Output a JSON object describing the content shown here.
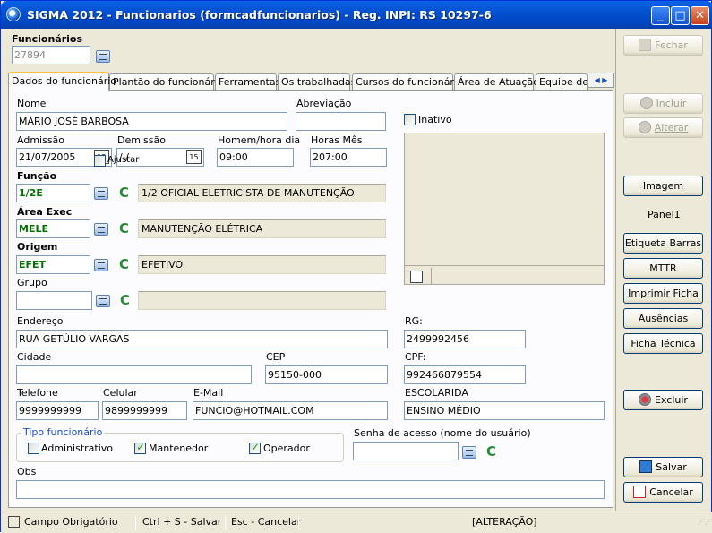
{
  "window": {
    "title": "SIGMA 2012 - Funcionarios  (formcadfuncionarios)  - Reg. INPI: RS 10297-6",
    "minimize": "_",
    "maximize": "□",
    "close": "✕"
  },
  "header": {
    "funcionarios_label": "Funcionários",
    "funcionario_code": "27894"
  },
  "tabs": [
    {
      "label": "Dados do funcionário"
    },
    {
      "label": "Plantão do funcionário"
    },
    {
      "label": "Ferramentas"
    },
    {
      "label": "Os trabalhadas"
    },
    {
      "label": "Cursos do funcionário"
    },
    {
      "label": "Área de Atuação"
    },
    {
      "label": "Equipe de"
    }
  ],
  "form": {
    "nome_label": "Nome",
    "nome": "MÁRIO JOSÉ BARBOSA",
    "abreviacao_label": "Abreviação",
    "abreviacao": "",
    "inativo_label": "Inativo",
    "admissao_label": "Admissão",
    "admissao": "21/07/2005",
    "demissao_label": "Demissão",
    "demissao": " /  /",
    "homem_hora_label": "Homem/hora dia",
    "homem_hora": "09:00",
    "horas_mes_label": "Horas Mês",
    "horas_mes": "207:00",
    "funcao_label": "Função",
    "funcao_code": "1/2E",
    "funcao_desc": "1/2 OFICIAL ELETRICISTA DE MANUTENÇÃO",
    "area_label": "Área Exec",
    "area_code": "MELE",
    "area_desc": "MANUTENÇÃO ELÉTRICA",
    "origem_label": "Origem",
    "origem_code": "EFET",
    "origem_desc": "EFETIVO",
    "grupo_label": "Grupo",
    "grupo_code": "",
    "grupo_desc": "",
    "c_label": "C",
    "ajustar_label": "Ajustar",
    "endereco_label": "Endereço",
    "endereco": "RUA GETÚLIO VARGAS",
    "rg_label": "RG:",
    "rg": "2499992456",
    "cidade_label": "Cidade",
    "cidade": "",
    "cep_label": "CEP",
    "cep": "95150-000",
    "cpf_label": "CPF:",
    "cpf": "992466879554",
    "telefone_label": "Telefone",
    "telefone": "9999999999",
    "celular_label": "Celular",
    "celular": "9899999999",
    "email_label": "E-Mail",
    "email": "FUNCIO@HOTMAIL.COM",
    "escolaridade_label": "ESCOLARIDA",
    "escolaridade": "ENSINO MÉDIO",
    "tipo_label": "Tipo funcionário",
    "tipo_administrativo": "Administrativo",
    "tipo_mantenedor": "Mantenedor",
    "tipo_operador": "Operador",
    "senha_label": "Senha de acesso (nome do usuário)",
    "senha": "",
    "obs_label": "Obs",
    "obs": ""
  },
  "sidebar": {
    "fechar": "Fechar",
    "incluir": "Incluir",
    "alterar": "Alterar",
    "imagem": "Imagem",
    "panel1": "Panel1",
    "etiqueta_barras": "Etiqueta Barras",
    "mttr": "MTTR",
    "imprimir_ficha": "Imprimir Ficha",
    "ausencias": "Ausências",
    "ficha_tecnica": "Ficha Técnica",
    "excluir": "Excluir",
    "salvar": "Salvar",
    "cancelar": "Cancelar"
  },
  "status": {
    "campo_obrigatorio": "Campo Obrigatório",
    "salvar_hint": "Ctrl + S - Salvar",
    "cancelar_hint": "Esc - Cancelar",
    "mode": "[ALTERAÇÃO]"
  },
  "colors": {
    "title_blue": "#0350d0",
    "code_green": "#007000",
    "c_green": "#2a8a3a"
  }
}
